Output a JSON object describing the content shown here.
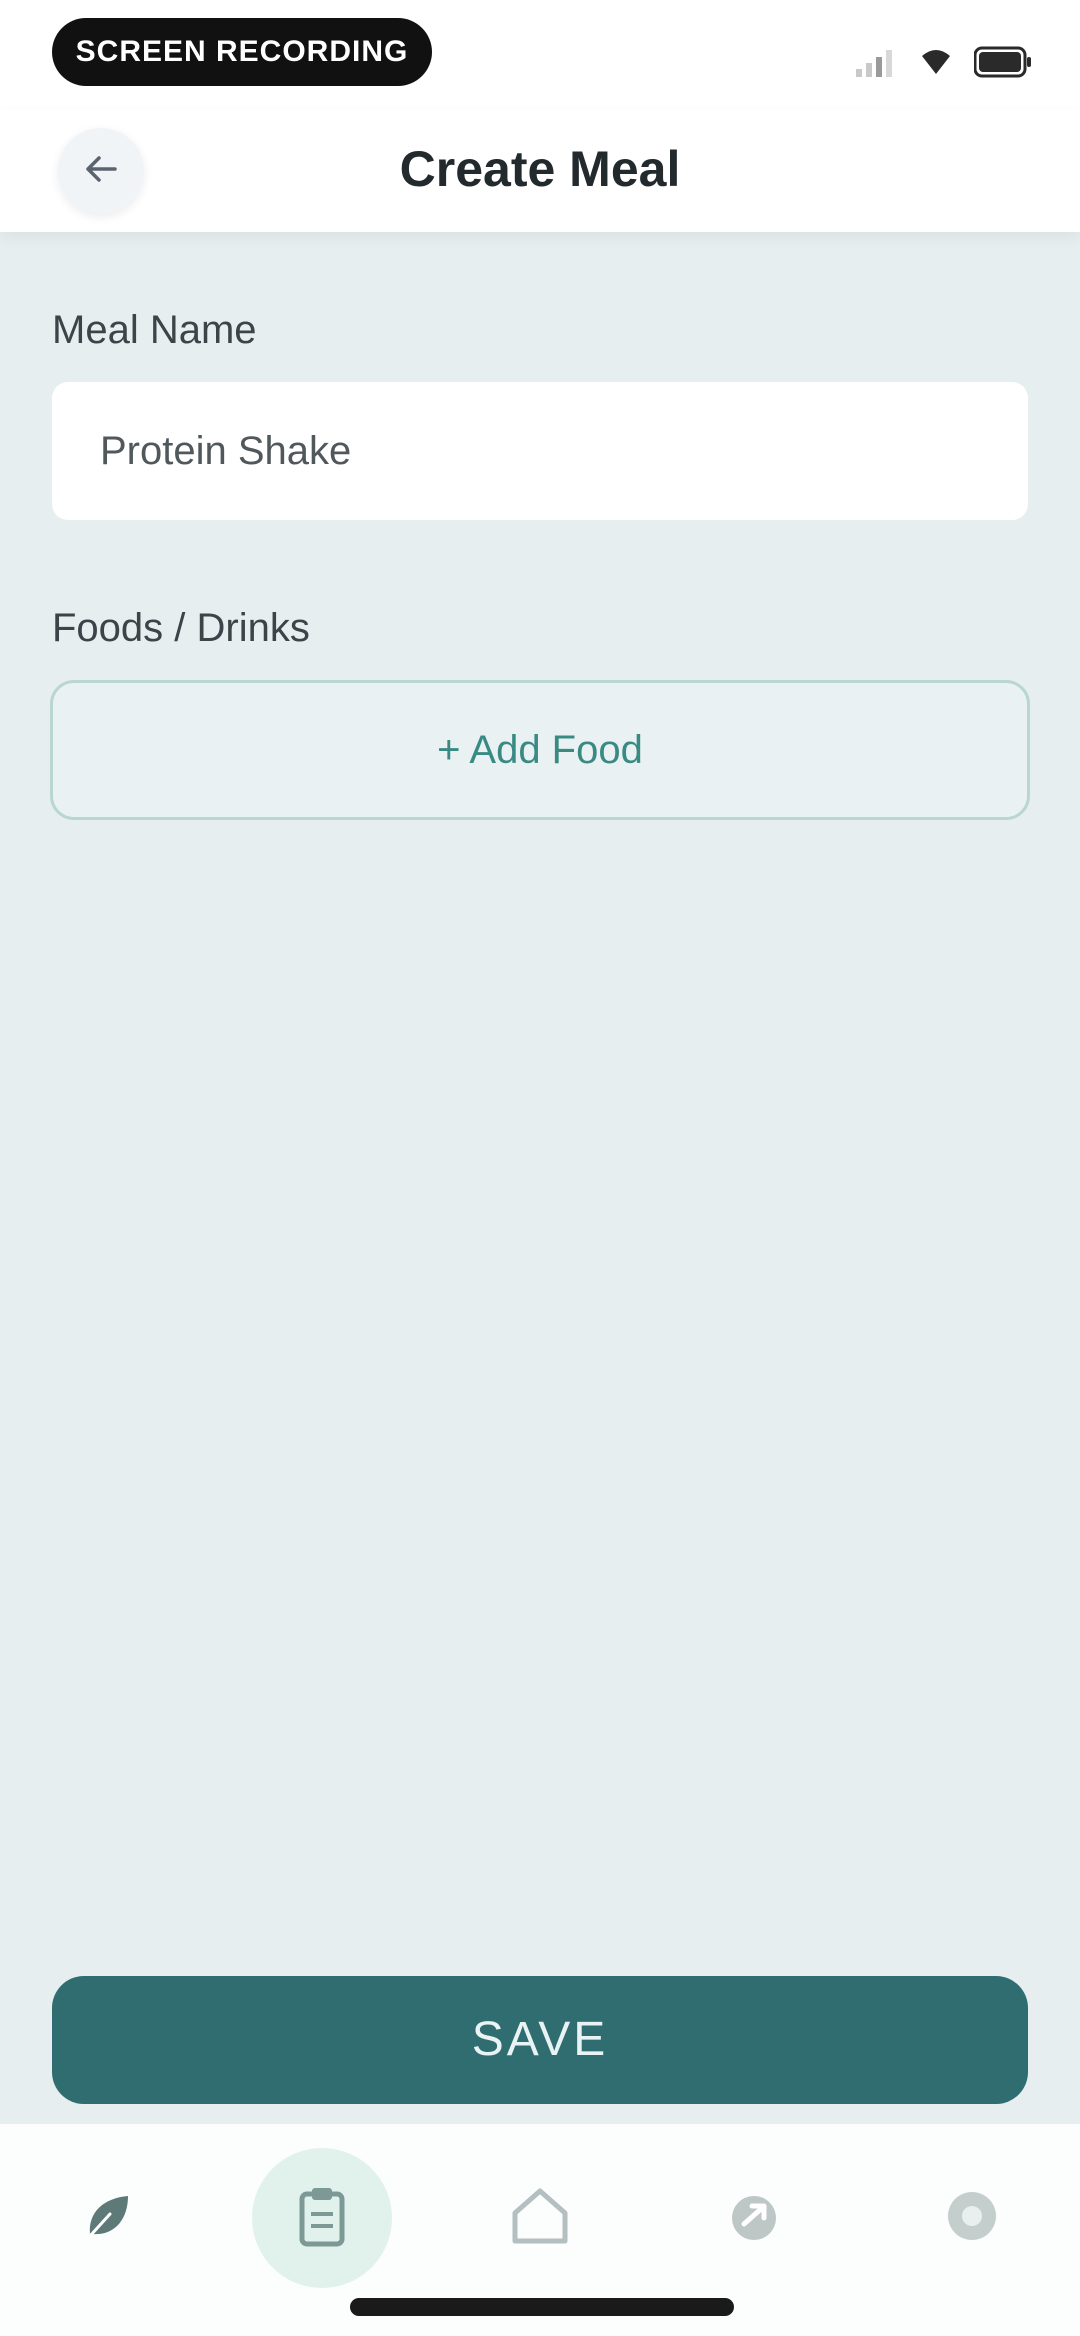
{
  "status_bar": {
    "pill_text": "SCREEN RECORDING"
  },
  "header": {
    "title": "Create Meal"
  },
  "form": {
    "meal_name_label": "Meal Name",
    "meal_name_value": "Protein Shake",
    "foods_label": "Foods / Drinks",
    "add_food_label": "+ Add Food"
  },
  "actions": {
    "save_label": "SAVE"
  },
  "nav": {
    "items": [
      {
        "icon": "leaf-icon"
      },
      {
        "icon": "clipboard-icon",
        "active": true
      },
      {
        "icon": "home-icon"
      },
      {
        "icon": "share-icon"
      },
      {
        "icon": "settings-icon"
      }
    ]
  },
  "colors": {
    "accent": "#2f6d70",
    "accent_light": "#3a8a84",
    "background": "#e6eef0",
    "nav_active_bg": "#e1f1ec"
  }
}
